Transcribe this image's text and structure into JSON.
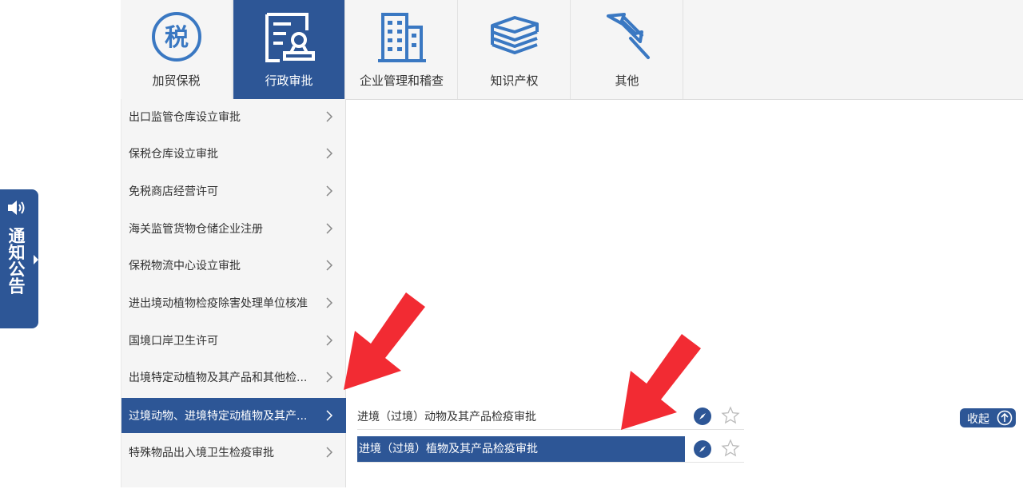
{
  "tabs": [
    {
      "label": "加贸保税",
      "icon": "tax-seal-icon",
      "icon_text": "税",
      "active": false
    },
    {
      "label": "行政审批",
      "icon": "approval-document-icon",
      "active": true
    },
    {
      "label": "企业管理和稽查",
      "icon": "building-icon",
      "active": false
    },
    {
      "label": "知识产权",
      "icon": "books-icon",
      "active": false
    },
    {
      "label": "其他",
      "icon": "pushpin-icon",
      "active": false
    }
  ],
  "menu": [
    {
      "label": "出口监管仓库设立审批",
      "selected": false
    },
    {
      "label": "保税仓库设立审批",
      "selected": false
    },
    {
      "label": "免税商店经营许可",
      "selected": false
    },
    {
      "label": "海关监管货物仓储企业注册",
      "selected": false
    },
    {
      "label": "保税物流中心设立审批",
      "selected": false
    },
    {
      "label": "进出境动植物检疫除害处理单位核准",
      "selected": false
    },
    {
      "label": "国境口岸卫生许可",
      "selected": false
    },
    {
      "label": "出境特定动植物及其产品和其他检...",
      "selected": false
    },
    {
      "label": "过境动物、进境特定动植物及其产...",
      "selected": true
    },
    {
      "label": "特殊物品出入境卫生检疫审批",
      "selected": false
    }
  ],
  "submenu": [
    {
      "label": "进境（过境）动物及其产品检疫审批",
      "selected": false
    },
    {
      "label": "进境（过境）植物及其产品检疫审批",
      "selected": true
    }
  ],
  "notice": {
    "label": "通知公告",
    "icon": "speaker-icon"
  },
  "collapse": {
    "label": "收起",
    "icon": "arrow-up-circle-icon"
  },
  "colors": {
    "primary": "#2d5696",
    "icon_blue": "#3a78c2",
    "arrow_red": "#f22b33",
    "background": "#f5f5f5"
  }
}
